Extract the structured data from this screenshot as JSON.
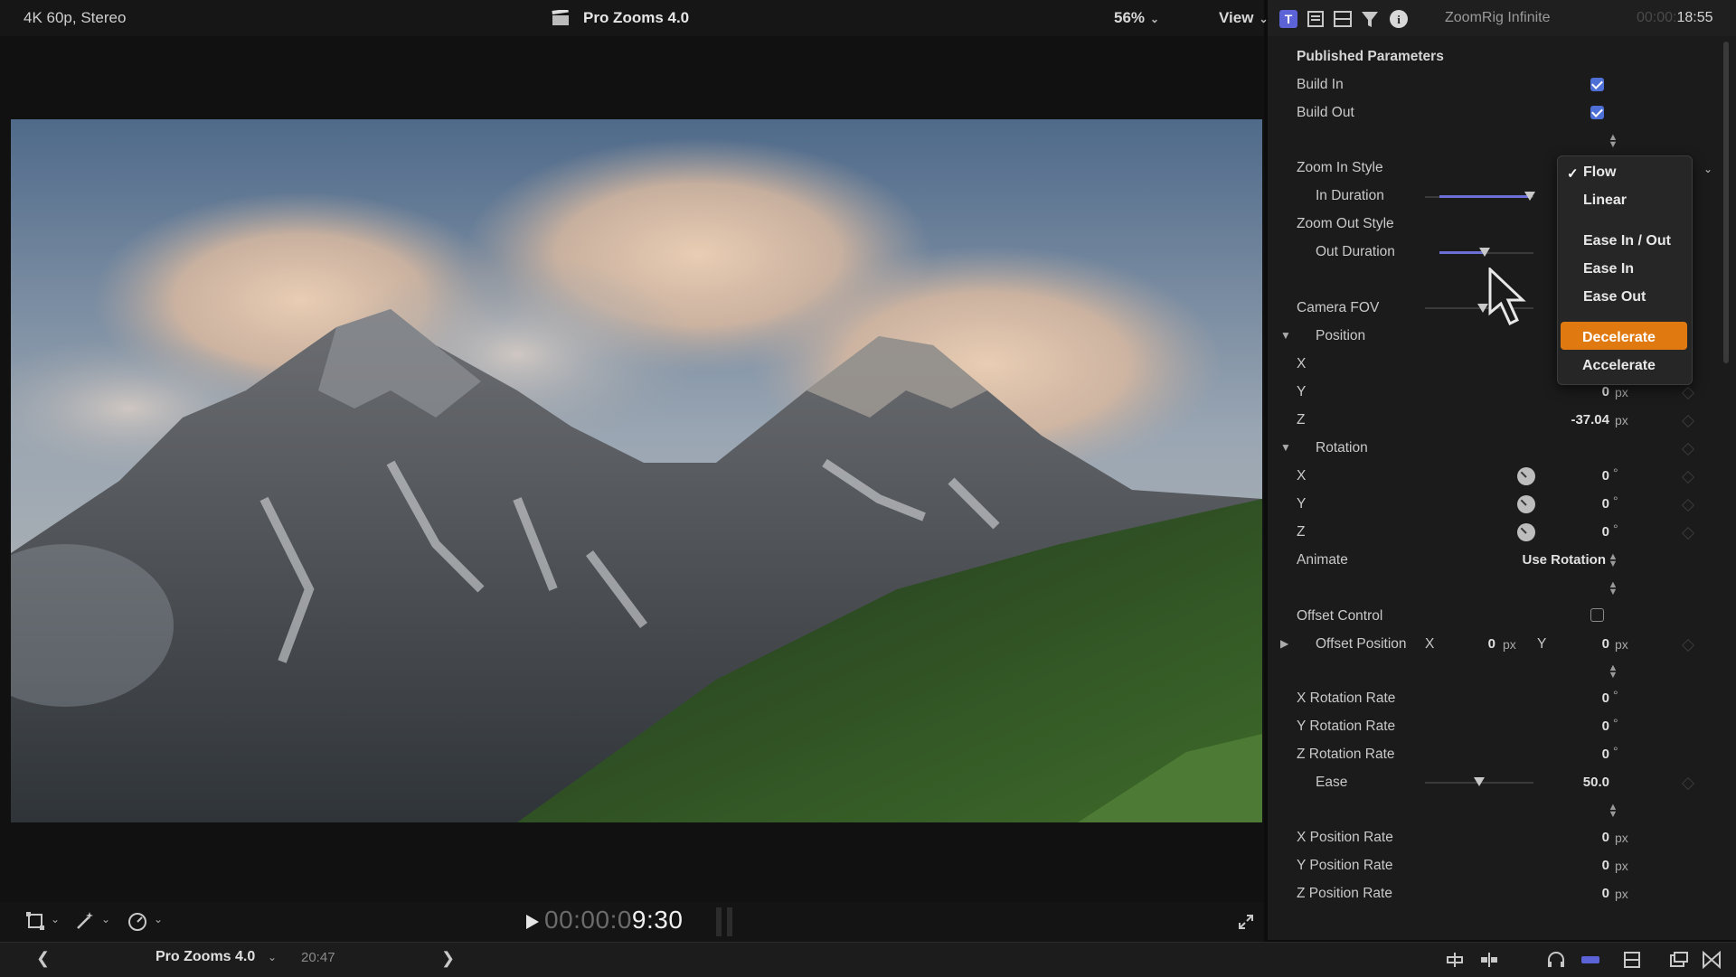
{
  "viewer": {
    "format": "4K 60p, Stereo",
    "title": "Pro Zooms 4.0",
    "zoom": "56%",
    "view_menu": "View",
    "timecode_dim": "00:00:0",
    "timecode_main": "9:30"
  },
  "inspector": {
    "title": "ZoomRig Infinite",
    "time_dim": "00:00:",
    "time_main": "18:55",
    "section": "Published Parameters",
    "params": {
      "build_in": "Build In",
      "build_out": "Build Out",
      "zoom_in_style": "Zoom In Style",
      "in_duration": "In Duration",
      "zoom_out_style": "Zoom Out Style",
      "out_duration": "Out Duration",
      "camera_fov": "Camera FOV",
      "position": "Position",
      "pos_x": "X",
      "pos_y": "Y",
      "pos_y_value": "0",
      "pos_z": "Z",
      "pos_z_value": "-37.04",
      "rotation": "Rotation",
      "rot_x": "X",
      "rot_y": "Y",
      "rot_z": "Z",
      "rot_x_value": "0",
      "rot_y_value": "0",
      "rot_z_value": "0",
      "animate": "Animate",
      "animate_value": "Use Rotation",
      "offset_control": "Offset Control",
      "offset_position": "Offset Position",
      "offset_x_label": "X",
      "offset_x_value": "0",
      "offset_y_label": "Y",
      "offset_y_value": "0",
      "x_rotation_rate": "X Rotation Rate",
      "y_rotation_rate": "Y Rotation Rate",
      "z_rotation_rate": "Z Rotation Rate",
      "x_rot_rate_value": "0",
      "y_rot_rate_value": "0",
      "z_rot_rate_value": "0",
      "ease": "Ease",
      "ease_value": "50.0",
      "x_position_rate": "X Position Rate",
      "y_position_rate": "Y Position Rate",
      "z_position_rate": "Z Position Rate",
      "x_pos_rate_value": "0",
      "y_pos_rate_value": "0",
      "z_pos_rate_value": "0"
    },
    "units": {
      "px": "px",
      "deg": "°"
    },
    "checkboxes": {
      "build_in": true,
      "build_out": true,
      "offset_control": false
    },
    "sliders": {
      "in_duration": 0.95,
      "out_duration": 0.44,
      "camera_fov": 0.52,
      "ease": 0.5
    }
  },
  "dropdown": {
    "selected": "Flow",
    "items": [
      "Flow",
      "Linear",
      "Ease In / Out",
      "Ease In",
      "Ease Out",
      "Decelerate",
      "Accelerate"
    ],
    "highlighted": "Decelerate"
  },
  "statusbar": {
    "project": "Pro Zooms 4.0",
    "duration": "20:47"
  },
  "colors": {
    "accent": "#e07a10",
    "checkbox": "#4d6fd6",
    "slider": "#6b6fd6"
  }
}
